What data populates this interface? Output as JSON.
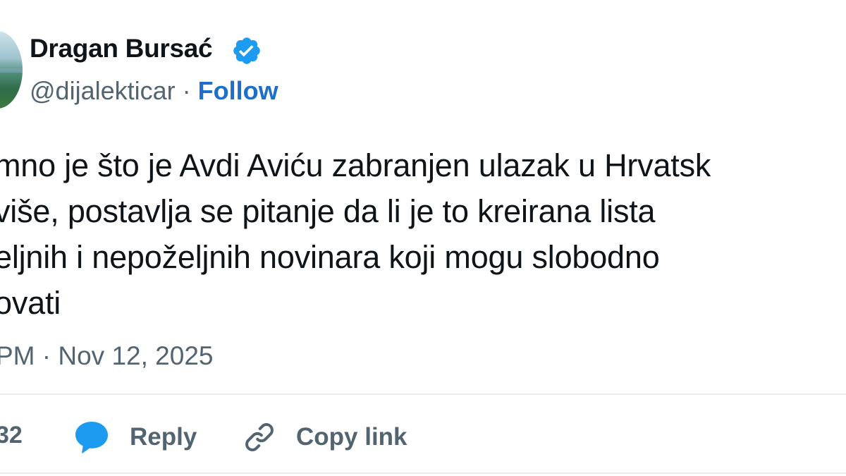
{
  "author": {
    "display_name": "Dragan Bursać",
    "handle": "@dijalekticar",
    "separator": "·",
    "follow_label": "Follow",
    "verified_color": "#1d9bf0"
  },
  "tweet": {
    "lines": [
      "mno je što je Avdi Aviću zabranjen ulazak u Hrvatsk",
      "više, postavlja se pitanje da li je to kreirana lista",
      "eljnih i nepoželjnih novinara koji mogu slobodno",
      "ovati"
    ],
    "timestamp": "PM · Nov 12, 2025"
  },
  "actions": {
    "like_count": "32",
    "reply_label": "Reply",
    "copy_link_label": "Copy link",
    "icons": [
      "speech-bubble-icon",
      "link-icon"
    ],
    "accent_color": "#1d9bf0"
  }
}
